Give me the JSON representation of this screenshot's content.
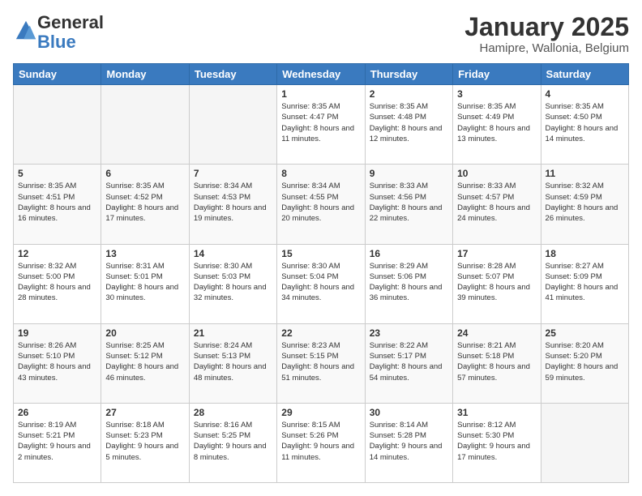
{
  "logo": {
    "general": "General",
    "blue": "Blue"
  },
  "header": {
    "month": "January 2025",
    "location": "Hamipre, Wallonia, Belgium"
  },
  "weekdays": [
    "Sunday",
    "Monday",
    "Tuesday",
    "Wednesday",
    "Thursday",
    "Friday",
    "Saturday"
  ],
  "weeks": [
    [
      {
        "day": "",
        "info": ""
      },
      {
        "day": "",
        "info": ""
      },
      {
        "day": "",
        "info": ""
      },
      {
        "day": "1",
        "info": "Sunrise: 8:35 AM\nSunset: 4:47 PM\nDaylight: 8 hours\nand 11 minutes."
      },
      {
        "day": "2",
        "info": "Sunrise: 8:35 AM\nSunset: 4:48 PM\nDaylight: 8 hours\nand 12 minutes."
      },
      {
        "day": "3",
        "info": "Sunrise: 8:35 AM\nSunset: 4:49 PM\nDaylight: 8 hours\nand 13 minutes."
      },
      {
        "day": "4",
        "info": "Sunrise: 8:35 AM\nSunset: 4:50 PM\nDaylight: 8 hours\nand 14 minutes."
      }
    ],
    [
      {
        "day": "5",
        "info": "Sunrise: 8:35 AM\nSunset: 4:51 PM\nDaylight: 8 hours\nand 16 minutes."
      },
      {
        "day": "6",
        "info": "Sunrise: 8:35 AM\nSunset: 4:52 PM\nDaylight: 8 hours\nand 17 minutes."
      },
      {
        "day": "7",
        "info": "Sunrise: 8:34 AM\nSunset: 4:53 PM\nDaylight: 8 hours\nand 19 minutes."
      },
      {
        "day": "8",
        "info": "Sunrise: 8:34 AM\nSunset: 4:55 PM\nDaylight: 8 hours\nand 20 minutes."
      },
      {
        "day": "9",
        "info": "Sunrise: 8:33 AM\nSunset: 4:56 PM\nDaylight: 8 hours\nand 22 minutes."
      },
      {
        "day": "10",
        "info": "Sunrise: 8:33 AM\nSunset: 4:57 PM\nDaylight: 8 hours\nand 24 minutes."
      },
      {
        "day": "11",
        "info": "Sunrise: 8:32 AM\nSunset: 4:59 PM\nDaylight: 8 hours\nand 26 minutes."
      }
    ],
    [
      {
        "day": "12",
        "info": "Sunrise: 8:32 AM\nSunset: 5:00 PM\nDaylight: 8 hours\nand 28 minutes."
      },
      {
        "day": "13",
        "info": "Sunrise: 8:31 AM\nSunset: 5:01 PM\nDaylight: 8 hours\nand 30 minutes."
      },
      {
        "day": "14",
        "info": "Sunrise: 8:30 AM\nSunset: 5:03 PM\nDaylight: 8 hours\nand 32 minutes."
      },
      {
        "day": "15",
        "info": "Sunrise: 8:30 AM\nSunset: 5:04 PM\nDaylight: 8 hours\nand 34 minutes."
      },
      {
        "day": "16",
        "info": "Sunrise: 8:29 AM\nSunset: 5:06 PM\nDaylight: 8 hours\nand 36 minutes."
      },
      {
        "day": "17",
        "info": "Sunrise: 8:28 AM\nSunset: 5:07 PM\nDaylight: 8 hours\nand 39 minutes."
      },
      {
        "day": "18",
        "info": "Sunrise: 8:27 AM\nSunset: 5:09 PM\nDaylight: 8 hours\nand 41 minutes."
      }
    ],
    [
      {
        "day": "19",
        "info": "Sunrise: 8:26 AM\nSunset: 5:10 PM\nDaylight: 8 hours\nand 43 minutes."
      },
      {
        "day": "20",
        "info": "Sunrise: 8:25 AM\nSunset: 5:12 PM\nDaylight: 8 hours\nand 46 minutes."
      },
      {
        "day": "21",
        "info": "Sunrise: 8:24 AM\nSunset: 5:13 PM\nDaylight: 8 hours\nand 48 minutes."
      },
      {
        "day": "22",
        "info": "Sunrise: 8:23 AM\nSunset: 5:15 PM\nDaylight: 8 hours\nand 51 minutes."
      },
      {
        "day": "23",
        "info": "Sunrise: 8:22 AM\nSunset: 5:17 PM\nDaylight: 8 hours\nand 54 minutes."
      },
      {
        "day": "24",
        "info": "Sunrise: 8:21 AM\nSunset: 5:18 PM\nDaylight: 8 hours\nand 57 minutes."
      },
      {
        "day": "25",
        "info": "Sunrise: 8:20 AM\nSunset: 5:20 PM\nDaylight: 8 hours\nand 59 minutes."
      }
    ],
    [
      {
        "day": "26",
        "info": "Sunrise: 8:19 AM\nSunset: 5:21 PM\nDaylight: 9 hours\nand 2 minutes."
      },
      {
        "day": "27",
        "info": "Sunrise: 8:18 AM\nSunset: 5:23 PM\nDaylight: 9 hours\nand 5 minutes."
      },
      {
        "day": "28",
        "info": "Sunrise: 8:16 AM\nSunset: 5:25 PM\nDaylight: 9 hours\nand 8 minutes."
      },
      {
        "day": "29",
        "info": "Sunrise: 8:15 AM\nSunset: 5:26 PM\nDaylight: 9 hours\nand 11 minutes."
      },
      {
        "day": "30",
        "info": "Sunrise: 8:14 AM\nSunset: 5:28 PM\nDaylight: 9 hours\nand 14 minutes."
      },
      {
        "day": "31",
        "info": "Sunrise: 8:12 AM\nSunset: 5:30 PM\nDaylight: 9 hours\nand 17 minutes."
      },
      {
        "day": "",
        "info": ""
      }
    ]
  ]
}
